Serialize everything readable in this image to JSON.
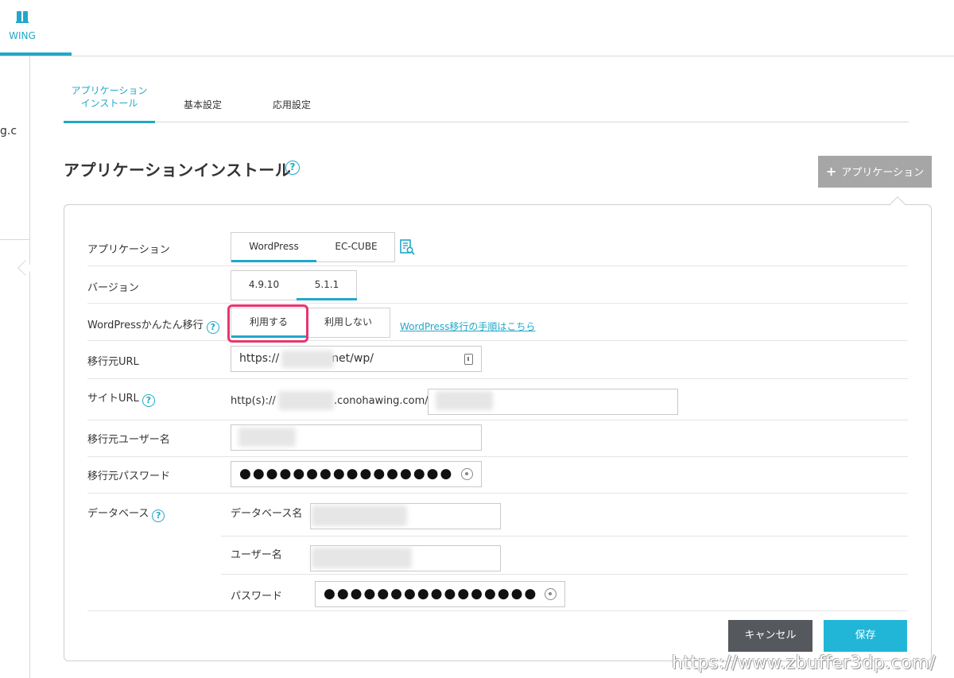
{
  "brand": {
    "label": "WING"
  },
  "sidebar": {
    "partial_text": "g.c"
  },
  "tabs": [
    {
      "label_line1": "アプリケーション",
      "label_line2": "インストール",
      "active": true
    },
    {
      "label": "基本設定",
      "active": false
    },
    {
      "label": "応用設定",
      "active": false
    }
  ],
  "page": {
    "title": "アプリケーションインストール",
    "help_glyph": "?"
  },
  "add_app_button": {
    "label": "アプリケーション"
  },
  "form": {
    "application": {
      "label": "アプリケーション",
      "options": [
        "WordPress",
        "EC-CUBE"
      ],
      "selected": "WordPress"
    },
    "version": {
      "label": "バージョン",
      "options": [
        "4.9.10",
        "5.1.1"
      ],
      "selected": "5.1.1"
    },
    "migration": {
      "label": "WordPressかんたん移行",
      "options": [
        "利用する",
        "利用しない"
      ],
      "selected": "利用する",
      "link": "WordPress移行の手順はこちら"
    },
    "source_url": {
      "label": "移行元URL",
      "value_prefix": "https://",
      "value_suffix": "net/wp/"
    },
    "site_url": {
      "label": "サイトURL",
      "prefix": "http(s)://",
      "domain_suffix": ".conohawing.com/"
    },
    "source_user": {
      "label": "移行元ユーザー名"
    },
    "source_password": {
      "label": "移行元パスワード",
      "masked": "●●●●●●●●●●●●●●●●"
    },
    "database": {
      "label": "データベース",
      "name_label": "データベース名",
      "user_label": "ユーザー名",
      "password_label": "パスワード",
      "password_masked": "●●●●●●●●●●●●●●●●"
    }
  },
  "actions": {
    "cancel": "キャンセル",
    "save": "保存"
  },
  "watermark": "https://www.zbuffer3dp.com/"
}
